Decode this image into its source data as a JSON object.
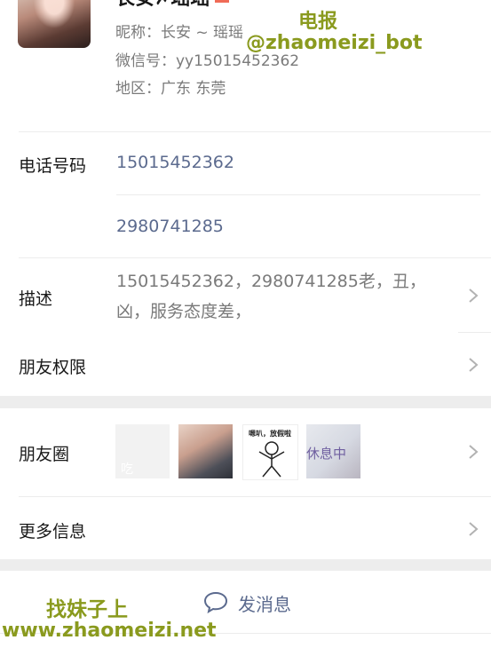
{
  "profile": {
    "name": "长安✗瑶瑶",
    "nickname": "昵称：长安 ~ 瑶瑶",
    "wechat_id": "微信号：yy15015452362",
    "region": "地区：广东  东莞"
  },
  "watermarks": {
    "top_line1": "电报",
    "top_line2": "@zhaomeizi_bot",
    "bottom_line1": "找妹子上",
    "bottom_line2": "www.zhaomeizi.net"
  },
  "phone": {
    "label": "电话号码",
    "numbers": [
      "15015452362",
      "2980741285"
    ]
  },
  "description": {
    "label": "描述",
    "text": "15015452362，2980741285老，丑，凶，服务态度差，"
  },
  "friend_permissions": {
    "label": "朋友权限"
  },
  "moments": {
    "label": "朋友圈",
    "thumb_texts": [
      "吃",
      "嗯叭，放假啦",
      "休息中"
    ]
  },
  "more_info": {
    "label": "更多信息"
  },
  "send_message": {
    "label": "发消息",
    "icon": "chat-bubble-icon"
  },
  "colors": {
    "link_blue": "#5b6a8e",
    "watermark": "#8a9a1e",
    "gray_text": "#7a7a7a"
  }
}
